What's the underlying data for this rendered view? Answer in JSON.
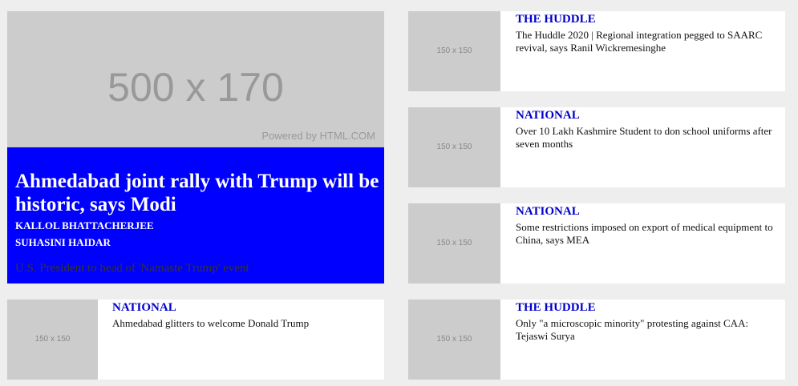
{
  "featured": {
    "image_placeholder": "500 x 170",
    "image_powered": "Powered by HTML.COM",
    "title": "Ahmedabad joint rally with Trump will be historic, says Modi",
    "authors": [
      "KALLOL BHATTACHERJEE",
      "SUHASINI HAIDAR"
    ],
    "summary": "U.S. President to head of 'Namaste Trump' event"
  },
  "thumbnail_placeholder": "150 x 150",
  "right_cards": [
    {
      "category": "THE HUDDLE",
      "title": "The Huddle 2020 | Regional integration pegged to SAARC revival, says Ranil Wickremesinghe"
    },
    {
      "category": "NATIONAL",
      "title": "Over 10 Lakh Kashmire Student to don school uniforms after seven months"
    },
    {
      "category": "NATIONAL",
      "title": "Some restrictions imposed on export of medical equipment to China, says MEA"
    },
    {
      "category": "THE HUDDLE",
      "title": "Only \"a microscopic minority\" protesting against CAA: Tejaswi Surya"
    }
  ],
  "left_cards": [
    {
      "category": "NATIONAL",
      "title": "Ahmedabad glitters to welcome Donald Trump"
    }
  ],
  "colors": {
    "featured_background": "#0000ff",
    "category_color": "#0000cc",
    "placeholder_gray": "#cccccc",
    "page_background": "#eeeeee"
  }
}
